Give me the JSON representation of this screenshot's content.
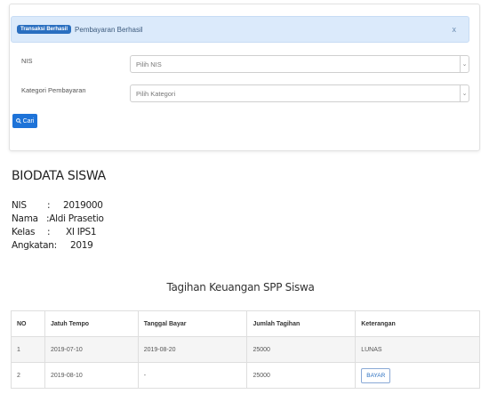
{
  "alert": {
    "badge": "Transaksi Berhasil",
    "message": "Pembayaran Berhasil",
    "close": "x"
  },
  "form": {
    "nis_label": "NIS",
    "nis_placeholder": "Pilih NIS",
    "kategori_label": "Kategori Pembayaran",
    "kategori_placeholder": "Pilih Kategori",
    "cari_label": "Cari"
  },
  "biodata": {
    "title": "BIODATA SISWA",
    "nis_label": "NIS",
    "nis_sep": ":",
    "nis_value": "2019000",
    "nama_label": "Nama",
    "nama_value": ":Aldi Prasetio",
    "kelas_label": "Kelas",
    "kelas_sep": ":",
    "kelas_value": "XI IPS1",
    "angkatan_label": "Angkatan:",
    "angkatan_value": "2019"
  },
  "tagihan": {
    "title": "Tagihan Keuangan SPP Siswa",
    "headers": [
      "NO",
      "Jatuh Tempo",
      "Tanggal Bayar",
      "Jumlah Tagihan",
      "Keterangan"
    ],
    "rows": [
      {
        "no": "1",
        "jatuh_tempo": "2019-07-10",
        "tanggal_bayar": "2019-08-20",
        "jumlah": "25000",
        "keterangan": "LUNAS"
      },
      {
        "no": "2",
        "jatuh_tempo": "2019-08-10",
        "tanggal_bayar": "-",
        "jumlah": "25000",
        "keterangan": "BAYAR"
      }
    ]
  }
}
